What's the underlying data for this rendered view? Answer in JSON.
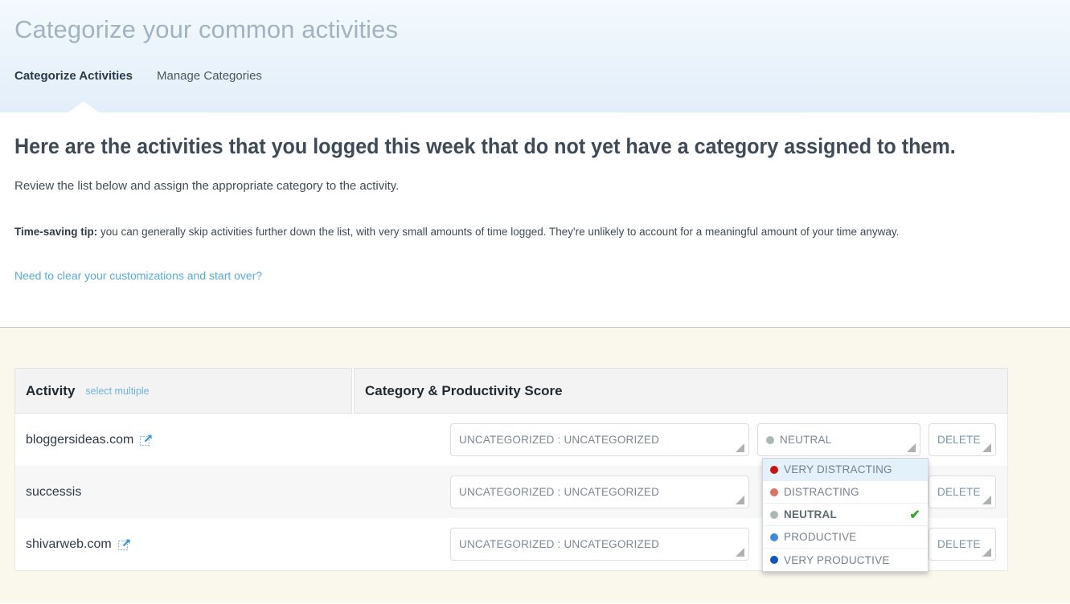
{
  "header": {
    "title": "Categorize your common activities",
    "tabs": [
      {
        "label": "Categorize Activities",
        "active": true
      },
      {
        "label": "Manage Categories",
        "active": false
      }
    ]
  },
  "intro": {
    "heading": "Here are the activities that you logged this week that do not yet have a category assigned to them.",
    "subtext": "Review the list below and assign the appropriate category to the activity.",
    "tip_label": "Time-saving tip:",
    "tip_text": " you can generally skip activities further down the list, with very small amounts of time logged. They're unlikely to account for a meaningful amount of your time anyway.",
    "reset_link": "Need to clear your customizations and start over?"
  },
  "table": {
    "columns": {
      "activity": "Activity",
      "activity_sub": "select multiple",
      "category": "Category & Productivity Score"
    },
    "rows": [
      {
        "activity": "bloggersideas.com",
        "has_external_link": true,
        "category_value": "UNCATEGORIZED : UNCATEGORIZED",
        "score_value": "NEUTRAL",
        "score_color": "#a8bab3",
        "delete_label": "DELETE"
      },
      {
        "activity": "successis",
        "has_external_link": false,
        "category_value": "UNCATEGORIZED : UNCATEGORIZED",
        "score_value": "",
        "score_color": "",
        "delete_label": "DELETE"
      },
      {
        "activity": "shivarweb.com",
        "has_external_link": true,
        "category_value": "UNCATEGORIZED : UNCATEGORIZED",
        "score_value": "",
        "score_color": "",
        "delete_label": "DELETE"
      }
    ]
  },
  "dropdown": {
    "open": true,
    "options": [
      {
        "label": "VERY DISTRACTING",
        "color": "#cc1111",
        "hovered": true,
        "selected": false
      },
      {
        "label": "DISTRACTING",
        "color": "#e0705f",
        "hovered": false,
        "selected": false
      },
      {
        "label": "NEUTRAL",
        "color": "#a8bab3",
        "hovered": false,
        "selected": true
      },
      {
        "label": "PRODUCTIVE",
        "color": "#3c8ade",
        "hovered": false,
        "selected": false
      },
      {
        "label": "VERY PRODUCTIVE",
        "color": "#0b57c4",
        "hovered": false,
        "selected": false
      }
    ],
    "check_glyph": "✔"
  },
  "colors": {
    "header_gradient_top": "#f4fafe",
    "header_gradient_bottom": "#e2eefa",
    "cream_background": "#faf7ec",
    "link_blue": "#55aadd",
    "heading_slate": "#3d4b58"
  }
}
